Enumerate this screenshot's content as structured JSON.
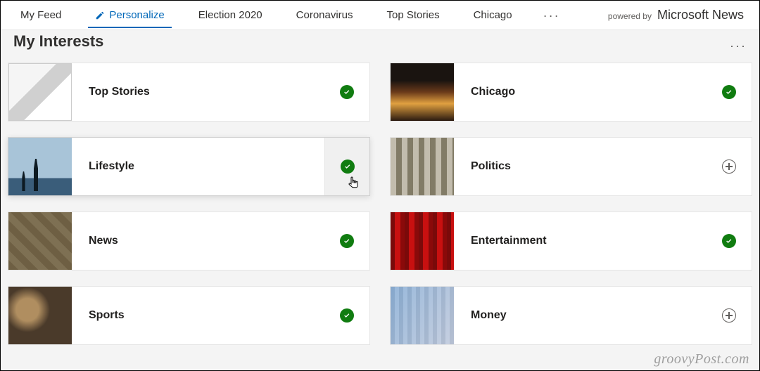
{
  "nav": {
    "items": [
      {
        "label": "My Feed",
        "active": false,
        "icon": null
      },
      {
        "label": "Personalize",
        "active": true,
        "icon": "pencil"
      },
      {
        "label": "Election 2020",
        "active": false,
        "icon": null
      },
      {
        "label": "Coronavirus",
        "active": false,
        "icon": null
      },
      {
        "label": "Top Stories",
        "active": false,
        "icon": null
      },
      {
        "label": "Chicago",
        "active": false,
        "icon": null
      }
    ],
    "more_glyph": "···"
  },
  "branding": {
    "powered_by": "powered by",
    "product": "Microsoft News"
  },
  "header": {
    "title": "My Interests",
    "more_glyph": "···"
  },
  "interests": {
    "left": [
      {
        "label": "Top Stories",
        "state": "followed",
        "thumb": "top-stories"
      },
      {
        "label": "Lifestyle",
        "state": "followed",
        "thumb": "lifestyle",
        "hovered": true
      },
      {
        "label": "News",
        "state": "followed",
        "thumb": "news"
      },
      {
        "label": "Sports",
        "state": "followed",
        "thumb": "sports"
      }
    ],
    "right": [
      {
        "label": "Chicago",
        "state": "followed",
        "thumb": "chicago"
      },
      {
        "label": "Politics",
        "state": "unfollowed",
        "thumb": "politics"
      },
      {
        "label": "Entertainment",
        "state": "followed",
        "thumb": "entertainment"
      },
      {
        "label": "Money",
        "state": "unfollowed",
        "thumb": "money"
      }
    ]
  },
  "colors": {
    "brand_blue": "#0067b8",
    "followed_green": "#107c10"
  },
  "watermark": "groovyPost.com"
}
